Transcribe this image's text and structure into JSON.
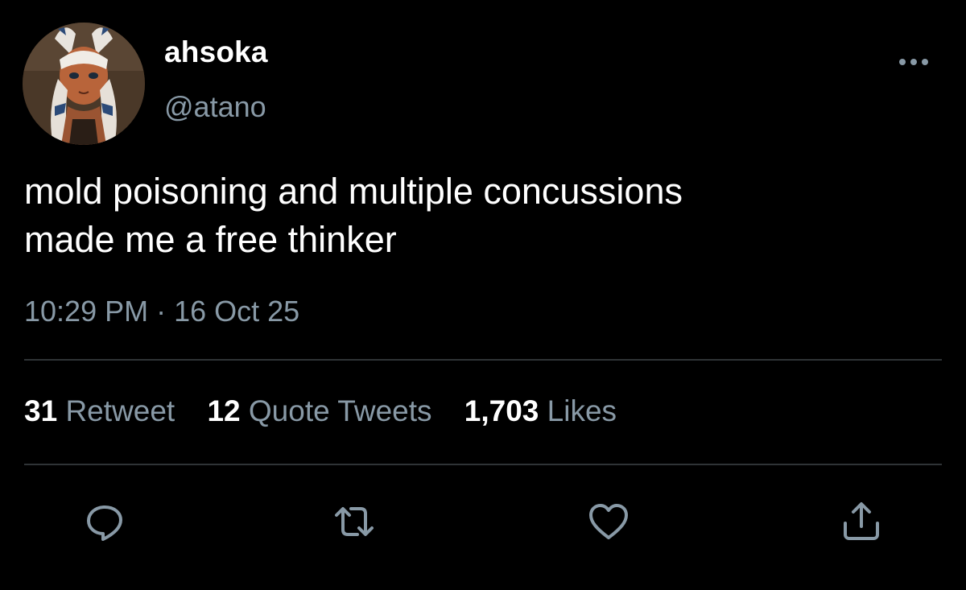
{
  "author": {
    "display_name": "ahsoka",
    "handle": "@atano"
  },
  "tweet": {
    "text_line1": "mold poisoning and multiple concussions",
    "text_line2": "made me a free thinker",
    "timestamp": "10:29 PM · 16 Oct 25"
  },
  "stats": {
    "retweets_count": "31",
    "retweets_label": "Retweet",
    "quotes_count": "12",
    "quotes_label": "Quote Tweets",
    "likes_count": "1,703",
    "likes_label": "Likes"
  },
  "actions": {
    "reply_icon": "reply-icon",
    "retweet_icon": "retweet-icon",
    "like_icon": "heart-icon",
    "share_icon": "share-icon"
  },
  "colors": {
    "background": "#000000",
    "primary_text": "#ffffff",
    "secondary_text": "#8899a6",
    "divider": "#2f3336"
  }
}
